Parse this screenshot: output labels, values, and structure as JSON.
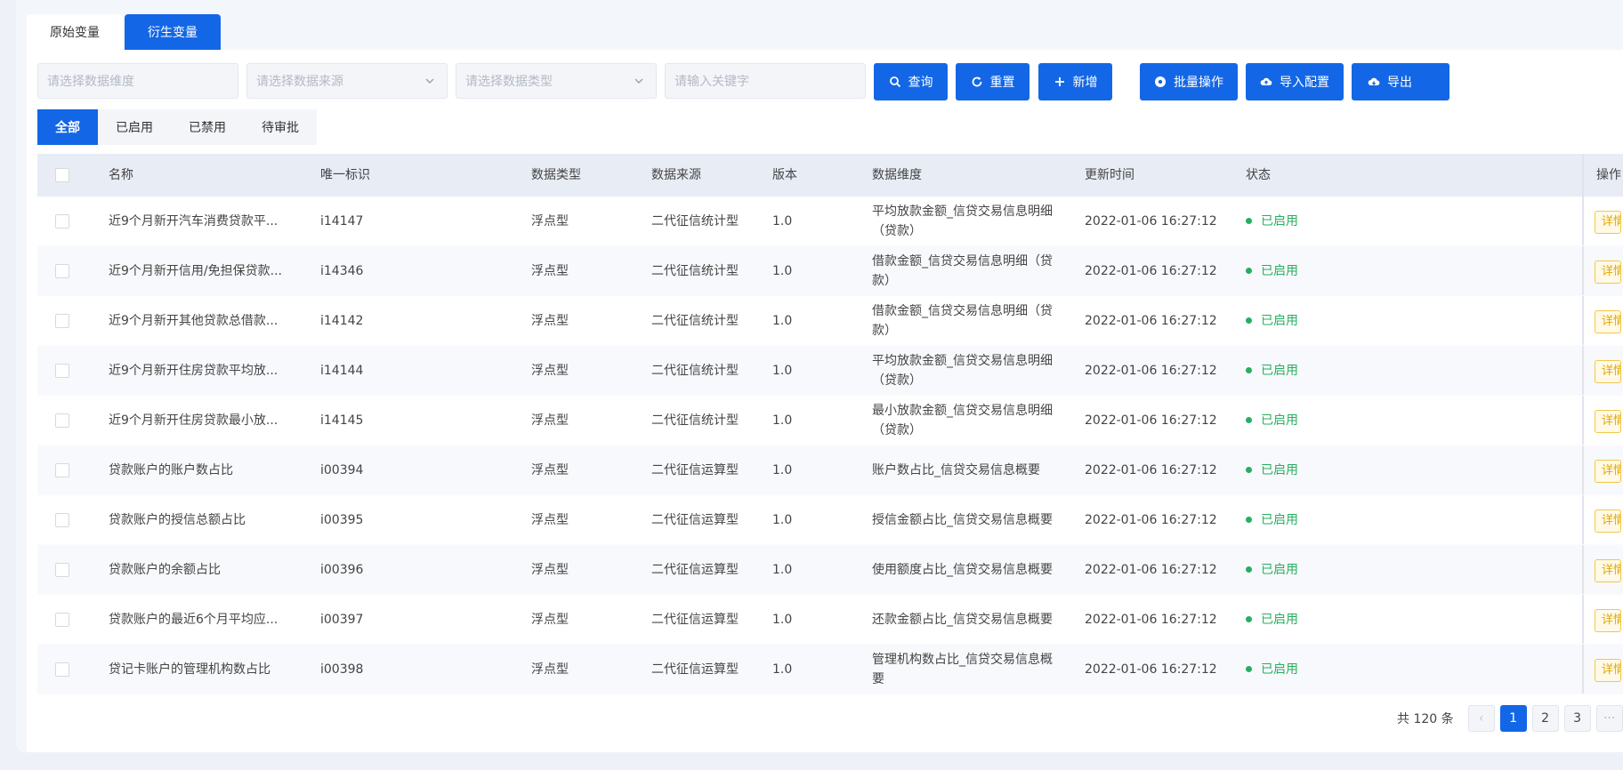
{
  "tabs": [
    {
      "label": "原始变量",
      "active": false
    },
    {
      "label": "衍生变量",
      "active": true
    }
  ],
  "filters": {
    "dimension_placeholder": "请选择数据维度",
    "source_placeholder": "请选择数据来源",
    "type_placeholder": "请选择数据类型",
    "keyword_placeholder": "请输入关键字"
  },
  "buttons": {
    "query": "查询",
    "reset": "重置",
    "add": "新增",
    "batch": "批量操作",
    "import": "导入配置",
    "export": "导出"
  },
  "status_tabs": [
    {
      "label": "全部",
      "active": true
    },
    {
      "label": "已启用",
      "active": false
    },
    {
      "label": "已禁用",
      "active": false
    },
    {
      "label": "待审批",
      "active": false
    }
  ],
  "table": {
    "headers": {
      "name": "名称",
      "id": "唯一标识",
      "type": "数据类型",
      "source": "数据来源",
      "version": "版本",
      "dimension": "数据维度",
      "updated": "更新时间",
      "status": "状态",
      "action": "操作"
    },
    "rows": [
      {
        "name": "近9个月新开汽车消费贷款平...",
        "id": "i14147",
        "type": "浮点型",
        "source": "二代征信统计型",
        "version": "1.0",
        "dimension": "平均放款金额_信贷交易信息明细（贷款）",
        "updated": "2022-01-06 16:27:12",
        "status": "已启用",
        "action": "详情"
      },
      {
        "name": "近9个月新开信用/免担保贷款...",
        "id": "i14346",
        "type": "浮点型",
        "source": "二代征信统计型",
        "version": "1.0",
        "dimension": "借款金额_信贷交易信息明细（贷款）",
        "updated": "2022-01-06 16:27:12",
        "status": "已启用",
        "action": "详情"
      },
      {
        "name": "近9个月新开其他贷款总借款...",
        "id": "i14142",
        "type": "浮点型",
        "source": "二代征信统计型",
        "version": "1.0",
        "dimension": "借款金额_信贷交易信息明细（贷款）",
        "updated": "2022-01-06 16:27:12",
        "status": "已启用",
        "action": "详情"
      },
      {
        "name": "近9个月新开住房贷款平均放...",
        "id": "i14144",
        "type": "浮点型",
        "source": "二代征信统计型",
        "version": "1.0",
        "dimension": "平均放款金额_信贷交易信息明细（贷款）",
        "updated": "2022-01-06 16:27:12",
        "status": "已启用",
        "action": "详情"
      },
      {
        "name": "近9个月新开住房贷款最小放...",
        "id": "i14145",
        "type": "浮点型",
        "source": "二代征信统计型",
        "version": "1.0",
        "dimension": "最小放款金额_信贷交易信息明细（贷款）",
        "updated": "2022-01-06 16:27:12",
        "status": "已启用",
        "action": "详情"
      },
      {
        "name": "贷款账户的账户数占比",
        "id": "i00394",
        "type": "浮点型",
        "source": "二代征信运算型",
        "version": "1.0",
        "dimension": "账户数占比_信贷交易信息概要",
        "updated": "2022-01-06 16:27:12",
        "status": "已启用",
        "action": "详情"
      },
      {
        "name": "贷款账户的授信总额占比",
        "id": "i00395",
        "type": "浮点型",
        "source": "二代征信运算型",
        "version": "1.0",
        "dimension": "授信金额占比_信贷交易信息概要",
        "updated": "2022-01-06 16:27:12",
        "status": "已启用",
        "action": "详情"
      },
      {
        "name": "贷款账户的余额占比",
        "id": "i00396",
        "type": "浮点型",
        "source": "二代征信运算型",
        "version": "1.0",
        "dimension": "使用额度占比_信贷交易信息概要",
        "updated": "2022-01-06 16:27:12",
        "status": "已启用",
        "action": "详情"
      },
      {
        "name": "贷款账户的最近6个月平均应...",
        "id": "i00397",
        "type": "浮点型",
        "source": "二代征信运算型",
        "version": "1.0",
        "dimension": "还款金额占比_信贷交易信息概要",
        "updated": "2022-01-06 16:27:12",
        "status": "已启用",
        "action": "详情"
      },
      {
        "name": "贷记卡账户的管理机构数占比",
        "id": "i00398",
        "type": "浮点型",
        "source": "二代征信运算型",
        "version": "1.0",
        "dimension": "管理机构数占比_信贷交易信息概要",
        "updated": "2022-01-06 16:27:12",
        "status": "已启用",
        "action": "详情"
      }
    ]
  },
  "pagination": {
    "total_label": "共 120 条",
    "prev": "‹",
    "pages": [
      "1",
      "2",
      "3"
    ],
    "current": "1",
    "more": "···"
  },
  "colors": {
    "primary": "#1367e6",
    "enabled": "#27ae60",
    "detail_tag": "#e0a800"
  }
}
